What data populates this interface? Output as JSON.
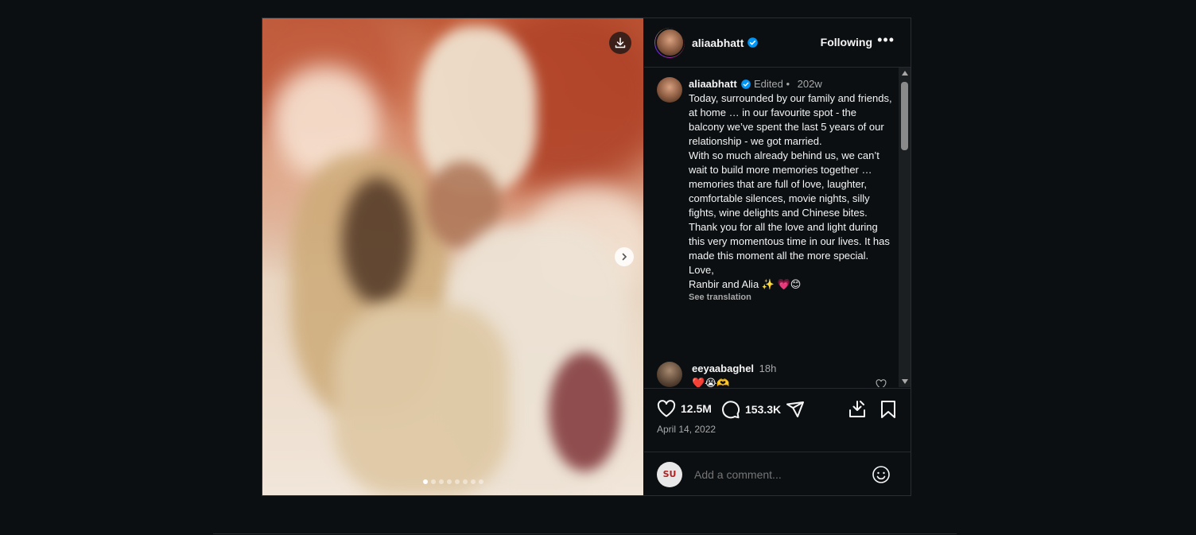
{
  "post": {
    "username": "aliaabhatt",
    "follow_state": "Following",
    "more_icon": "more-horizontal-icon",
    "carousel": {
      "slide_count": 8,
      "active_index": 0
    }
  },
  "caption": {
    "username": "aliaabhatt",
    "edited": "Edited",
    "separator": "•",
    "age": "202w",
    "paragraphs": [
      "Today, surrounded by our family and friends, at home … in our favourite spot - the balcony we’ve spent the last 5 years of our relationship - we got married.",
      "With so much already behind us, we can’t wait to build more memories together … memories that are full of love, laughter, comfortable silences, movie nights, silly fights, wine delights and Chinese bites.",
      "Thank you for all the love and light during this very momentous time in our lives. It has made this moment all the more special.",
      "Love,",
      "Ranbir and Alia ✨ 💗😊"
    ],
    "see_translation": "See translation"
  },
  "comment": {
    "username": "eeyaabaghel",
    "age": "18h",
    "text": "❤️😭🫶"
  },
  "actions": {
    "likes": "12.5M",
    "comments": "153.3K",
    "date": "April 14, 2022"
  },
  "add_comment": {
    "placeholder": "Add a comment...",
    "avatar_text": "SU"
  },
  "colors": {
    "background": "#0b0f12",
    "verified": "#0095f6",
    "text_secondary": "#a8a8a8"
  }
}
